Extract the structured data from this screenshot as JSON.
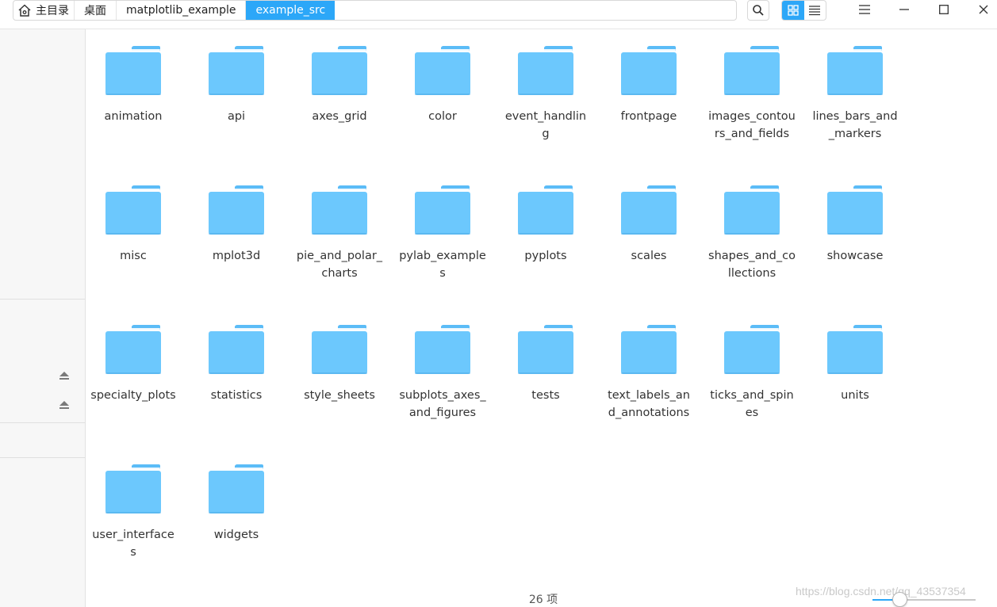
{
  "breadcrumb": {
    "items": [
      "主目录",
      "桌面",
      "matplotlib_example",
      "example_src"
    ],
    "active_index": 3
  },
  "toolbar": {
    "search_icon": "search-icon",
    "icon_view_icon": "grid-view-icon",
    "list_view_icon": "list-view-icon",
    "view_mode": "icon"
  },
  "window_controls": [
    "menu-icon",
    "minimize-icon",
    "maximize-icon",
    "close-icon"
  ],
  "folders": [
    "animation",
    "api",
    "axes_grid",
    "color",
    "event_handling",
    "frontpage",
    "images_contours_and_fields",
    "lines_bars_and_markers",
    "misc",
    "mplot3d",
    "pie_and_polar_charts",
    "pylab_examples",
    "pyplots",
    "scales",
    "shapes_and_collections",
    "showcase",
    "specialty_plots",
    "statistics",
    "style_sheets",
    "subplots_axes_and_figures",
    "tests",
    "text_labels_and_annotations",
    "ticks_and_spines",
    "units",
    "user_interfaces",
    "widgets"
  ],
  "status": {
    "count_text": "26 项"
  },
  "watermark": "https://blog.csdn.net/qq_43537354",
  "zoom": {
    "level": 0.27
  },
  "colors": {
    "accent": "#2ca7f8",
    "folder": "#6cc8fd",
    "folder_tab": "#5bbcf7"
  }
}
